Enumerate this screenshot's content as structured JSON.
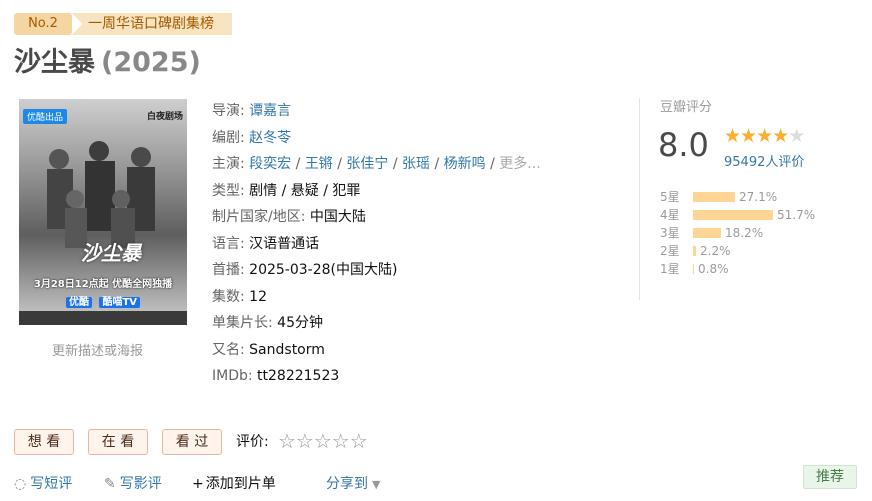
{
  "banner": {
    "rank": "No.2",
    "list": "一周华语口碑剧集榜"
  },
  "title": {
    "name": "沙尘暴",
    "year": "(2025)"
  },
  "poster": {
    "tag": "优酷出品",
    "studio": "白夜剧场",
    "calligraphy": "沙尘暴",
    "line1": "3月28日12点起 优酷全网独播",
    "platform1": "优酷",
    "platform2": "酷喵TV"
  },
  "update_link": "更新描述或海报",
  "info": {
    "director_label": "导演:",
    "director": "谭嘉言",
    "writer_label": "编剧:",
    "writer": "赵冬苓",
    "cast_label": "主演:",
    "cast": [
      "段奕宏",
      "王锵",
      "张佳宁",
      "张瑶",
      "杨新鸣"
    ],
    "cast_more": "更多...",
    "genre_label": "类型:",
    "genres": "剧情 / 悬疑 / 犯罪",
    "country_label": "制片国家/地区:",
    "country": "中国大陆",
    "lang_label": "语言:",
    "lang": "汉语普通话",
    "premiere_label": "首播:",
    "premiere": "2025-03-28(中国大陆)",
    "episodes_label": "集数:",
    "episodes": "12",
    "duration_label": "单集片长:",
    "duration": "45分钟",
    "aka_label": "又名:",
    "aka": "Sandstorm",
    "imdb_label": "IMDb:",
    "imdb": "tt28221523"
  },
  "rating": {
    "title": "豆瓣评分",
    "score": "8.0",
    "stars_filled": 4,
    "votes": "95492人评价",
    "distribution": [
      {
        "label": "5星",
        "pct": "27.1%",
        "value": 27.1
      },
      {
        "label": "4星",
        "pct": "51.7%",
        "value": 51.7
      },
      {
        "label": "3星",
        "pct": "18.2%",
        "value": 18.2
      },
      {
        "label": "2星",
        "pct": "2.2%",
        "value": 2.2
      },
      {
        "label": "1星",
        "pct": "0.8%",
        "value": 0.8
      }
    ]
  },
  "actions": {
    "want": "想 看",
    "watching": "在 看",
    "watched": "看 过",
    "rate_label": "评价:",
    "short_review": "写短评",
    "review": "写影评",
    "add_list": "添加到片单",
    "share": "分享到",
    "recommend": "推荐"
  },
  "colors": {
    "link": "#3377aa",
    "star": "#ffac2d",
    "bar": "#ffd596",
    "banner_bg": "#f5d6a3"
  }
}
